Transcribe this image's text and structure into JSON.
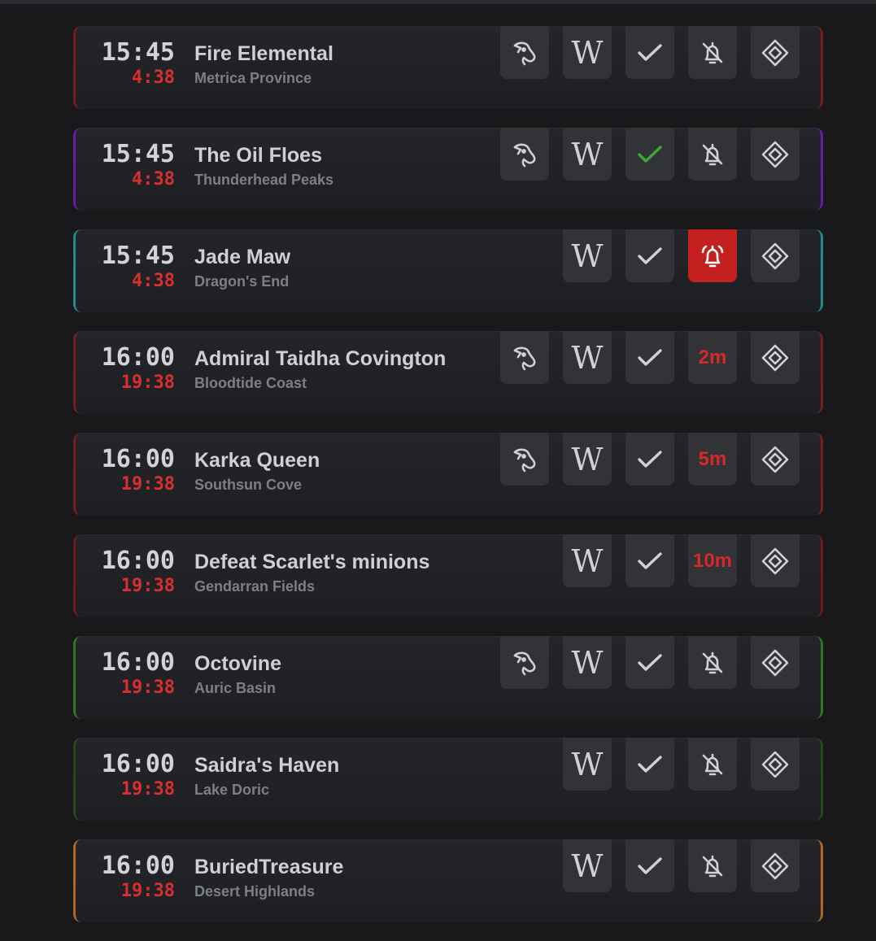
{
  "colors": {
    "background": "#19191b",
    "card": "#222328",
    "button": "#323337",
    "countdown_red": "#d9302e",
    "check_green": "#3aa935",
    "alarm_active": "#c4201f"
  },
  "events": [
    {
      "time": "15:45",
      "countdown": "4:38",
      "name": "Fire Elemental",
      "zone": "Metrica Province",
      "accent": "#7a1c1c",
      "waypoint_icon": true,
      "done": false,
      "alarm": "off",
      "alarm_text": ""
    },
    {
      "time": "15:45",
      "countdown": "4:38",
      "name": "The Oil Floes",
      "zone": "Thunderhead Peaks",
      "accent": "#6a1aa6",
      "waypoint_icon": true,
      "done": true,
      "alarm": "off",
      "alarm_text": ""
    },
    {
      "time": "15:45",
      "countdown": "4:38",
      "name": "Jade Maw",
      "zone": "Dragon's End",
      "accent": "#1f8d8f",
      "waypoint_icon": false,
      "done": false,
      "alarm": "on",
      "alarm_text": ""
    },
    {
      "time": "16:00",
      "countdown": "19:38",
      "name": "Admiral Taidha Covington",
      "zone": "Bloodtide Coast",
      "accent": "#7a1c1c",
      "waypoint_icon": true,
      "done": false,
      "alarm": "timer",
      "alarm_text": "2m"
    },
    {
      "time": "16:00",
      "countdown": "19:38",
      "name": "Karka Queen",
      "zone": "Southsun Cove",
      "accent": "#7a1c1c",
      "waypoint_icon": true,
      "done": false,
      "alarm": "timer",
      "alarm_text": "5m"
    },
    {
      "time": "16:00",
      "countdown": "19:38",
      "name": "Defeat Scarlet's minions",
      "zone": "Gendarran Fields",
      "accent": "#6e1a1a",
      "waypoint_icon": false,
      "done": false,
      "alarm": "timer",
      "alarm_text": "10m"
    },
    {
      "time": "16:00",
      "countdown": "19:38",
      "name": "Octovine",
      "zone": "Auric Basin",
      "accent": "#2b7a22",
      "waypoint_icon": true,
      "done": false,
      "alarm": "off",
      "alarm_text": ""
    },
    {
      "time": "16:00",
      "countdown": "19:38",
      "name": "Saidra's Haven",
      "zone": "Lake Doric",
      "accent": "#1e4d1a",
      "waypoint_icon": false,
      "done": false,
      "alarm": "off",
      "alarm_text": ""
    },
    {
      "time": "16:00",
      "countdown": "19:38",
      "name": "BuriedTreasure",
      "zone": "Desert Highlands",
      "accent": "#b4661c",
      "waypoint_icon": false,
      "done": false,
      "alarm": "off",
      "alarm_text": ""
    }
  ],
  "icons": {
    "waypoint": "horse-head-icon",
    "wiki": "wikipedia-icon",
    "done": "checkmark-icon",
    "alarm_off": "bell-off-icon",
    "alarm_on": "alarm-bell-icon",
    "chat_link": "diamond-icon"
  },
  "wiki_glyph": "W"
}
